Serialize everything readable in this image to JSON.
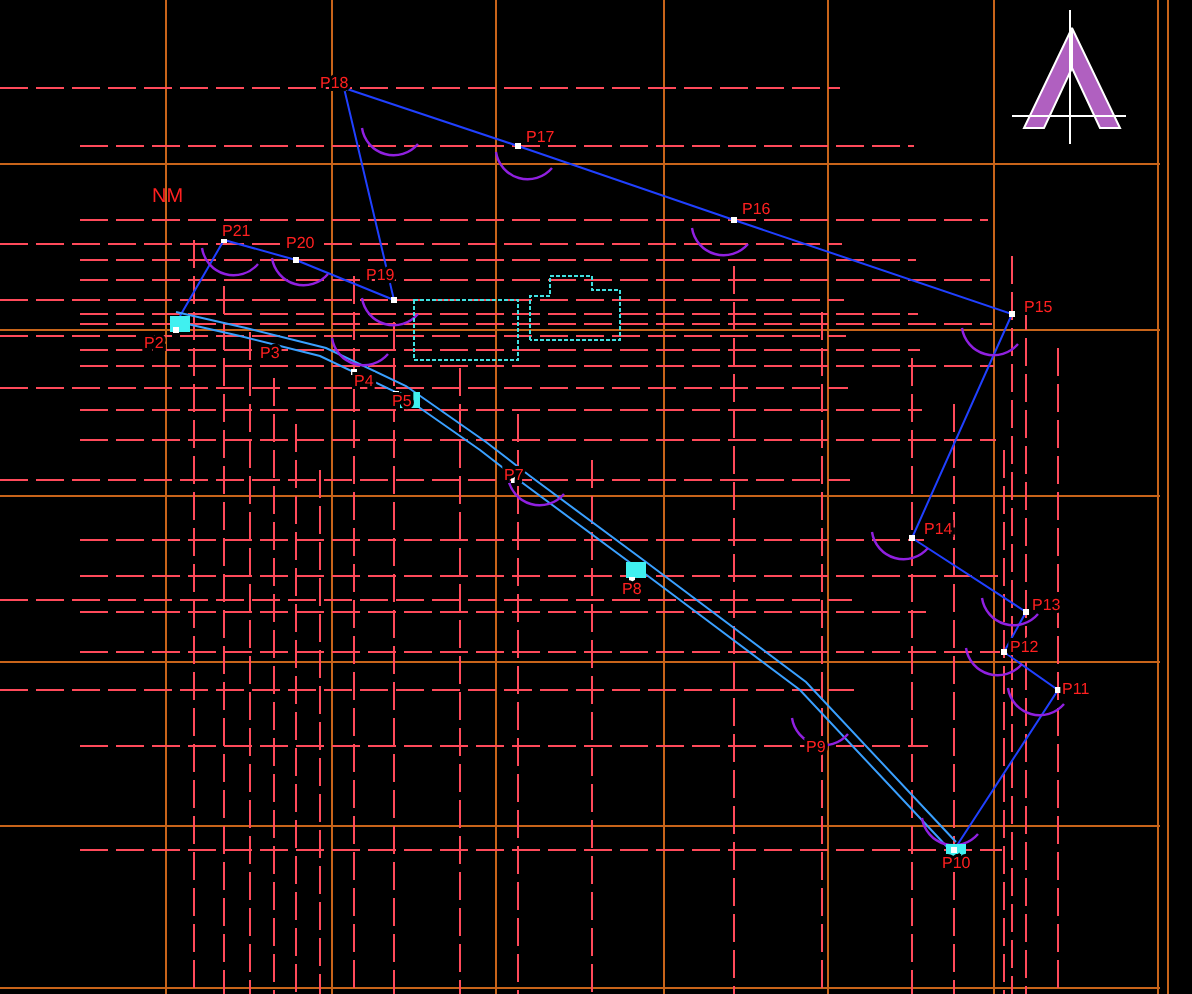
{
  "north_label": "NM",
  "point_labels": [
    "P18",
    "P17",
    "P16",
    "P15",
    "P14",
    "P13",
    "P12",
    "P11",
    "P10",
    "P9",
    "P19",
    "P20",
    "P21",
    "P2",
    "P3",
    "P4",
    "P5",
    "P7",
    "P8"
  ]
}
